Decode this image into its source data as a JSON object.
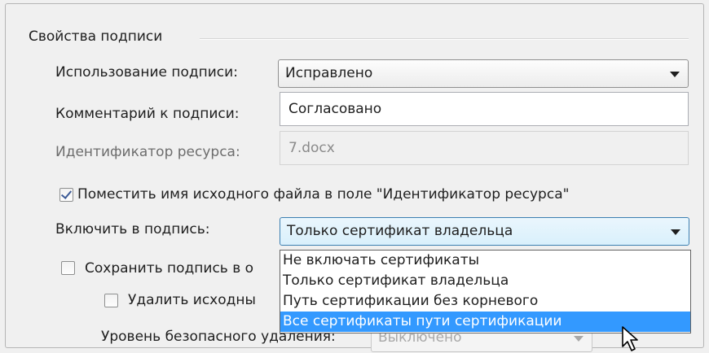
{
  "group": {
    "title": "Свойства подписи"
  },
  "fields": {
    "usage": {
      "label": "Использование подписи:",
      "value": "Исправлено"
    },
    "comment": {
      "label": "Комментарий к подписи:",
      "value": "Согласовано"
    },
    "resource": {
      "label": "Идентификатор ресурса:",
      "value": "7.docx"
    }
  },
  "checkboxes": {
    "put_filename": {
      "label": "Поместить имя исходного файла в поле \"Идентификатор ресурса\"",
      "checked": true
    },
    "save_signature": {
      "label": "Сохранить подпись в о",
      "checked": false
    },
    "delete_source": {
      "label": "Удалить исходны",
      "checked": false
    }
  },
  "include": {
    "label": "Включить в подпись:",
    "value": "Только сертификат владельца",
    "options": [
      "Не включать сертификаты",
      "Только сертификат владельца",
      "Путь сертификации без корневого",
      "Все сертификаты пути сертификации"
    ],
    "highlighted_index": 3
  },
  "secure_delete": {
    "label": "Уровень безопасного удаления:",
    "value": "Выключено"
  },
  "colors": {
    "selection": "#3399ff",
    "checkmark": "#3c5a96"
  }
}
